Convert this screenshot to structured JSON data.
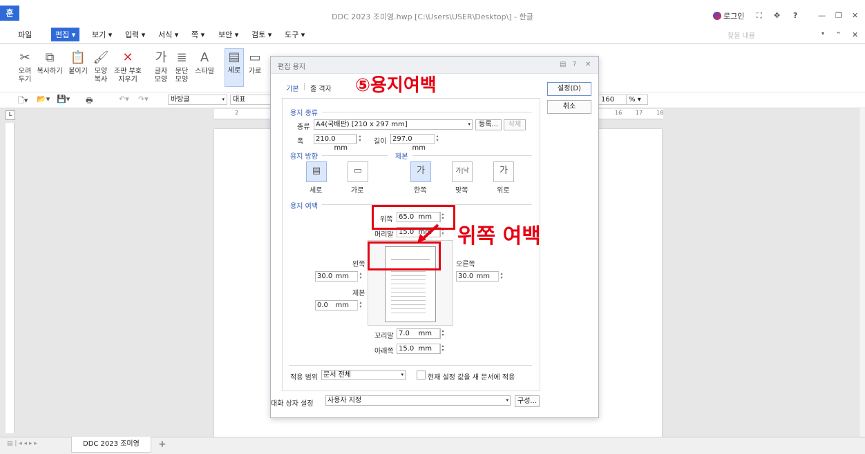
{
  "app": {
    "logo": "훈",
    "window_title": "DDC 2023 조미영.hwp [C:\\Users\\USER\\Desktop\\] - 한글",
    "login": "로그인",
    "help": "?"
  },
  "menu": {
    "items": [
      "파일",
      "편집",
      "보기",
      "입력",
      "서식",
      "쪽",
      "보안",
      "검토",
      "도구"
    ],
    "search_placeholder": "찾을 내용"
  },
  "ribbon": {
    "items": [
      {
        "label": "오려 두기",
        "icon": "scissors-icon"
      },
      {
        "label": "복사하기",
        "icon": "copy-icon"
      },
      {
        "label": "붙이기",
        "icon": "paste-icon"
      },
      {
        "label": "모양 복사",
        "icon": "format-copy-icon"
      },
      {
        "label": "조판 부호 지우기",
        "icon": "clear-code-icon"
      },
      {
        "label": "글자 모양",
        "icon": "char-shape-icon"
      },
      {
        "label": "문단 모양",
        "icon": "para-shape-icon"
      },
      {
        "label": "스타일",
        "icon": "style-icon"
      },
      {
        "label": "세로",
        "icon": "portrait-icon"
      },
      {
        "label": "가로",
        "icon": "landscape-icon"
      }
    ]
  },
  "format_bar": {
    "style": "바탕글",
    "font": "대표",
    "zoom": "160",
    "zoom_unit": "%"
  },
  "ruler_marks": [
    "2",
    "16",
    "17",
    "18"
  ],
  "dialog": {
    "title": "편집 용지",
    "tabs": [
      "기본",
      "줄 격자"
    ],
    "ok_label": "설정(D)",
    "cancel_label": "취소",
    "paper_type": {
      "section": "용지 종류",
      "kind_label": "종류",
      "kind_value": "A4(국배판) [210 x 297 mm]",
      "register": "등록...",
      "delete": "삭제",
      "width_label": "폭",
      "width_value": "210.0",
      "height_label": "길이",
      "height_value": "297.0",
      "unit": "mm"
    },
    "orientation": {
      "section": "용지 방향",
      "portrait": "세로",
      "landscape": "가로"
    },
    "binding": {
      "section": "제본",
      "one_side": "한쪽",
      "facing": "맞쪽",
      "top": "위로",
      "glyph": "가"
    },
    "margins": {
      "section": "용지 여백",
      "top_label": "위쪽",
      "top_value": "65.0",
      "header_label": "머리말",
      "header_value": "15.0",
      "left_label": "왼쪽",
      "left_value": "30.0",
      "right_label": "오른쪽",
      "right_value": "30.0",
      "gutter_label": "제본",
      "gutter_value": "0.0",
      "footer_label": "꼬리말",
      "footer_value": "7.0",
      "bottom_label": "아래쪽",
      "bottom_value": "15.0"
    },
    "apply_scope_label": "적용 범위",
    "apply_scope_value": "문서 전체",
    "apply_new_doc": "현재 설정 값을 새 문서에 적용",
    "dialog_setting_label": "대화 상자 설정",
    "dialog_setting_value": "사용자 지정",
    "config_button": "구성..."
  },
  "annotations": {
    "title": "⑤용지여백",
    "callout": "위쪽 여백",
    "color": "#e60012"
  },
  "status": {
    "doc_tab": "DDC 2023 조미영",
    "add_tab": "+"
  },
  "colors": {
    "accent": "#2f6bd8",
    "section_blue": "#2f5bb7"
  }
}
